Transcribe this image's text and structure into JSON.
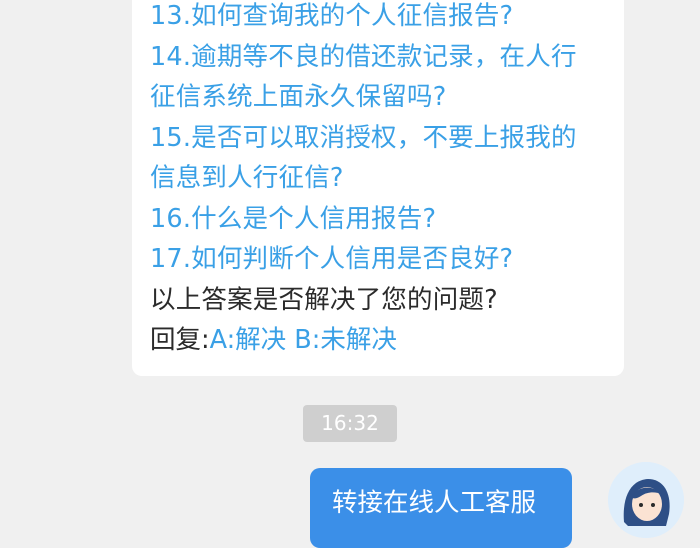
{
  "bot_message": {
    "questions": [
      "13.如何查询我的个人征信报告?",
      "14.逾期等不良的借还款记录，在人行",
      "征信系统上面永久保留吗?",
      "15.是否可以取消授权，不要上报我的",
      "信息到人行征信?",
      "16.什么是个人信用报告?",
      "17.如何判断个人信用是否良好?"
    ],
    "prompt": "以上答案是否解决了您的问题?",
    "reply_prefix": "回复:",
    "option_a": "A:解决",
    "option_b": "B:未解决"
  },
  "timestamp": "16:32",
  "user_message": {
    "text": "转接在线人工客服"
  },
  "colors": {
    "link": "#3aa0e6",
    "user_bubble": "#3b8fe8",
    "background": "#f0f0f0"
  },
  "icons": {
    "avatar": "agent-avatar-icon"
  }
}
